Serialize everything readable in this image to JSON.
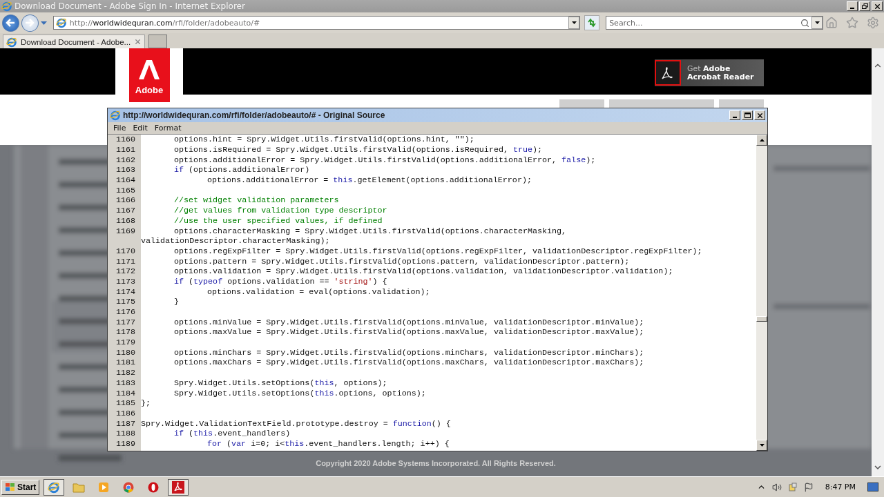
{
  "browser": {
    "title": "Download Document - Adobe Sign In - Internet Explorer",
    "address": {
      "scheme": "http://",
      "domain": "worldwidequran.com",
      "path": "/rfi/folder/adobeauto/#"
    },
    "search": {
      "placeholder": "Search..."
    },
    "tabs": [
      {
        "label": "Download Document - Adobe...",
        "selected": true
      }
    ]
  },
  "page": {
    "logo_text": "Adobe",
    "reader_button": {
      "line_1": "Get **Adobe**",
      "line_2": "Acrobat Reader"
    },
    "nav_buttons": [
      {
        "kind": "short"
      },
      {
        "kind": "wide"
      },
      {
        "kind": "short"
      }
    ],
    "copyright": "Copyright 2020 Adobe Systems Incorporated. All Rights Reserved."
  },
  "source_window": {
    "title": "http://worldwidequran.com/rfi/folder/adobeauto/# - Original Source",
    "menu": [
      "File",
      "Edit",
      "Format"
    ],
    "lines": [
      {
        "number": "1160",
        "tokens": [
          {
            "kind": "plain",
            "text": "\toptions.hint = Spry.Widget.Utils.firstValid(options.hint, \"\");"
          }
        ]
      },
      {
        "number": "1161",
        "tokens": [
          {
            "kind": "plain",
            "text": "\toptions.isRequired = Spry.Widget.Utils.firstValid(options.isRequired, "
          },
          {
            "kind": "keyword",
            "text": "true"
          },
          {
            "kind": "plain",
            "text": ");"
          }
        ]
      },
      {
        "number": "1162",
        "tokens": [
          {
            "kind": "plain",
            "text": "\toptions.additionalError = Spry.Widget.Utils.firstValid(options.additionalError, "
          },
          {
            "kind": "keyword",
            "text": "false"
          },
          {
            "kind": "plain",
            "text": ");"
          }
        ]
      },
      {
        "number": "1163",
        "tokens": [
          {
            "kind": "keyword",
            "text": "\tif"
          },
          {
            "kind": "plain",
            "text": " (options.additionalError)"
          }
        ]
      },
      {
        "number": "1164",
        "tokens": [
          {
            "kind": "plain",
            "text": "\t\toptions.additionalError = "
          },
          {
            "kind": "keyword",
            "text": "this"
          },
          {
            "kind": "plain",
            "text": ".getElement(options.additionalError);"
          }
        ]
      },
      {
        "number": "1165"
      },
      {
        "number": "1166",
        "tokens": [
          {
            "kind": "comment",
            "text": "\t//set widget validation parameters"
          }
        ]
      },
      {
        "number": "1167",
        "tokens": [
          {
            "kind": "comment",
            "text": "\t//get values from validation type descriptor"
          }
        ]
      },
      {
        "number": "1168",
        "tokens": [
          {
            "kind": "comment",
            "text": "\t//use the user specified values, if defined"
          }
        ]
      },
      {
        "number": "1169",
        "tokens": [
          {
            "kind": "plain",
            "text": "\toptions.characterMasking = Spry.Widget.Utils.firstValid(options.characterMasking,"
          }
        ]
      },
      {
        "tokens": [
          {
            "kind": "plain",
            "text": "validationDescriptor.characterMasking);"
          }
        ]
      },
      {
        "number": "1170",
        "tokens": [
          {
            "kind": "plain",
            "text": "\toptions.regExpFilter = Spry.Widget.Utils.firstValid(options.regExpFilter, validationDescriptor.regExpFilter);"
          }
        ]
      },
      {
        "number": "1171",
        "tokens": [
          {
            "kind": "plain",
            "text": "\toptions.pattern = Spry.Widget.Utils.firstValid(options.pattern, validationDescriptor.pattern);"
          }
        ]
      },
      {
        "number": "1172",
        "tokens": [
          {
            "kind": "plain",
            "text": "\toptions.validation = Spry.Widget.Utils.firstValid(options.validation, validationDescriptor.validation);"
          }
        ]
      },
      {
        "number": "1173",
        "tokens": [
          {
            "kind": "keyword",
            "text": "\tif"
          },
          {
            "kind": "plain",
            "text": " ("
          },
          {
            "kind": "keyword",
            "text": "typeof"
          },
          {
            "kind": "plain",
            "text": " options.validation == "
          },
          {
            "kind": "string",
            "text": "'string'"
          },
          {
            "kind": "plain",
            "text": ") {"
          }
        ]
      },
      {
        "number": "1174",
        "tokens": [
          {
            "kind": "plain",
            "text": "\t\toptions.validation = eval(options.validation);"
          }
        ]
      },
      {
        "number": "1175",
        "tokens": [
          {
            "kind": "plain",
            "text": "\t}"
          }
        ]
      },
      {
        "number": "1176"
      },
      {
        "number": "1177",
        "tokens": [
          {
            "kind": "plain",
            "text": "\toptions.minValue = Spry.Widget.Utils.firstValid(options.minValue, validationDescriptor.minValue);"
          }
        ]
      },
      {
        "number": "1178",
        "tokens": [
          {
            "kind": "plain",
            "text": "\toptions.maxValue = Spry.Widget.Utils.firstValid(options.maxValue, validationDescriptor.maxValue);"
          }
        ]
      },
      {
        "number": "1179"
      },
      {
        "number": "1180",
        "tokens": [
          {
            "kind": "plain",
            "text": "\toptions.minChars = Spry.Widget.Utils.firstValid(options.minChars, validationDescriptor.minChars);"
          }
        ]
      },
      {
        "number": "1181",
        "tokens": [
          {
            "kind": "plain",
            "text": "\toptions.maxChars = Spry.Widget.Utils.firstValid(options.maxChars, validationDescriptor.maxChars);"
          }
        ]
      },
      {
        "number": "1182"
      },
      {
        "number": "1183",
        "tokens": [
          {
            "kind": "plain",
            "text": "\tSpry.Widget.Utils.setOptions("
          },
          {
            "kind": "keyword",
            "text": "this"
          },
          {
            "kind": "plain",
            "text": ", options);"
          }
        ]
      },
      {
        "number": "1184",
        "tokens": [
          {
            "kind": "plain",
            "text": "\tSpry.Widget.Utils.setOptions("
          },
          {
            "kind": "keyword",
            "text": "this"
          },
          {
            "kind": "plain",
            "text": ".options, options);"
          }
        ]
      },
      {
        "number": "1185",
        "tokens": [
          {
            "kind": "plain",
            "text": "};"
          }
        ]
      },
      {
        "number": "1186"
      },
      {
        "number": "1187",
        "tokens": [
          {
            "kind": "plain",
            "text": "Spry.Widget.ValidationTextField.prototype.destroy = "
          },
          {
            "kind": "keyword",
            "text": "function"
          },
          {
            "kind": "plain",
            "text": "() {"
          }
        ]
      },
      {
        "number": "1188",
        "tokens": [
          {
            "kind": "keyword",
            "text": "\tif"
          },
          {
            "kind": "plain",
            "text": " ("
          },
          {
            "kind": "keyword",
            "text": "this"
          },
          {
            "kind": "plain",
            "text": ".event_handlers)"
          }
        ]
      },
      {
        "number": "1189",
        "tokens": [
          {
            "kind": "keyword",
            "text": "\t\tfor"
          },
          {
            "kind": "plain",
            "text": " ("
          },
          {
            "kind": "keyword",
            "text": "var"
          },
          {
            "kind": "plain",
            "text": " i=0; i<"
          },
          {
            "kind": "keyword",
            "text": "this"
          },
          {
            "kind": "plain",
            "text": ".event_handlers.length; i++) {"
          }
        ]
      }
    ]
  },
  "taskbar": {
    "start": "Start",
    "clock": "8:47 PM",
    "apps": [
      {
        "kind": "ie",
        "open": true
      },
      {
        "kind": "folder",
        "open": false
      },
      {
        "kind": "media",
        "open": false
      },
      {
        "kind": "chrome",
        "open": false
      },
      {
        "kind": "opera",
        "open": false
      },
      {
        "kind": "acrobat",
        "open": true
      }
    ]
  }
}
